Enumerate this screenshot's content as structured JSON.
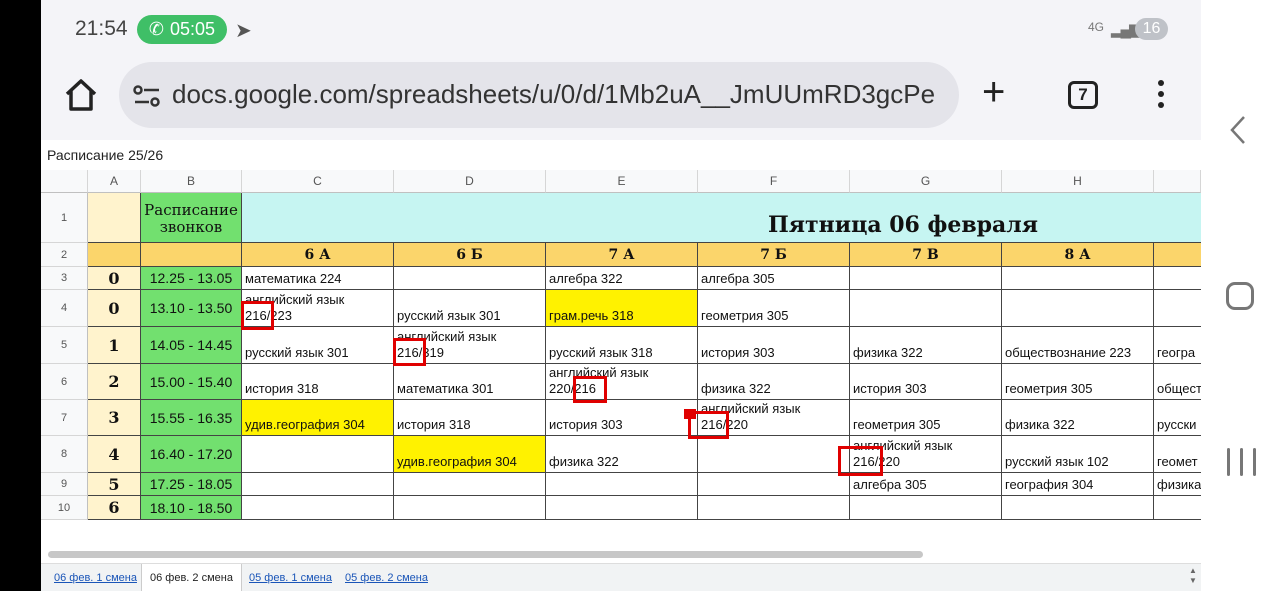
{
  "status_bar": {
    "time": "21:54",
    "call_timer": "05:05",
    "network": "4G",
    "battery": "16"
  },
  "browser": {
    "url": "docs.google.com/spreadsheets/u/0/d/1Mb2uA__JmUUmRD3gcPe",
    "tab_count": "7"
  },
  "sheet": {
    "title": "Расписание 25/26",
    "columns": [
      "A",
      "B",
      "C",
      "D",
      "E",
      "F",
      "G",
      "H"
    ],
    "rows": [
      "1",
      "2",
      "3",
      "4",
      "5",
      "6",
      "7",
      "8",
      "9",
      "10"
    ],
    "bell_header": "Расписание звонков",
    "day_title": "Пятница 06 февраля",
    "classes": [
      "6 А",
      "6 Б",
      "7 А",
      "7 Б",
      "7 В",
      "8 А"
    ],
    "lessons": [
      {
        "num": "0",
        "time": "12.25 - 13.05",
        "cells": [
          "математика 224",
          "",
          "алгебра 322",
          "алгебра 305",
          "",
          "",
          ""
        ]
      },
      {
        "num": "0",
        "time": "13.10 - 13.50",
        "cells": [
          "английский язык\n216/223",
          "русский язык 301",
          "грам.речь 318",
          "геометрия 305",
          "",
          "",
          ""
        ]
      },
      {
        "num": "1",
        "time": "14.05 - 14.45",
        "cells": [
          "русский язык 301",
          "английский язык\n216/319",
          "русский язык 318",
          "история 303",
          "физика 322",
          "обществознание 223",
          "геогра"
        ]
      },
      {
        "num": "2",
        "time": "15.00 - 15.40",
        "cells": [
          "история 318",
          "математика 301",
          "английский язык\n220/216",
          "физика 322",
          "история 303",
          "геометрия 305",
          "общест"
        ]
      },
      {
        "num": "3",
        "time": "15.55 - 16.35",
        "cells": [
          "удив.география 304",
          "история 318",
          "история 303",
          "английский язык\n216/220",
          "геометрия 305",
          "физика 322",
          "русски"
        ]
      },
      {
        "num": "4",
        "time": "16.40 - 17.20",
        "cells": [
          "",
          "удив.география 304",
          "физика 322",
          "",
          "английский язык\n216/220",
          "русский язык 102",
          "геомет"
        ]
      },
      {
        "num": "5",
        "time": "17.25 - 18.05",
        "cells": [
          "",
          "",
          "",
          "",
          "алгебра 305",
          "география 304",
          "физика"
        ]
      },
      {
        "num": "6",
        "time": "18.10 - 18.50",
        "cells": [
          "",
          "",
          "",
          "",
          "",
          "",
          ""
        ]
      }
    ],
    "sheet_tabs": [
      "06 фев. 1 смена",
      "06 фев. 2 смена",
      "05 фев. 1 смена",
      "05 фев. 2 смена"
    ]
  },
  "colors": {
    "bell_green": "#72e06f",
    "class_header": "#fbd56b",
    "highlight": "#fff200",
    "day_banner": "#c6f5f2",
    "annotation": "#e00000"
  }
}
